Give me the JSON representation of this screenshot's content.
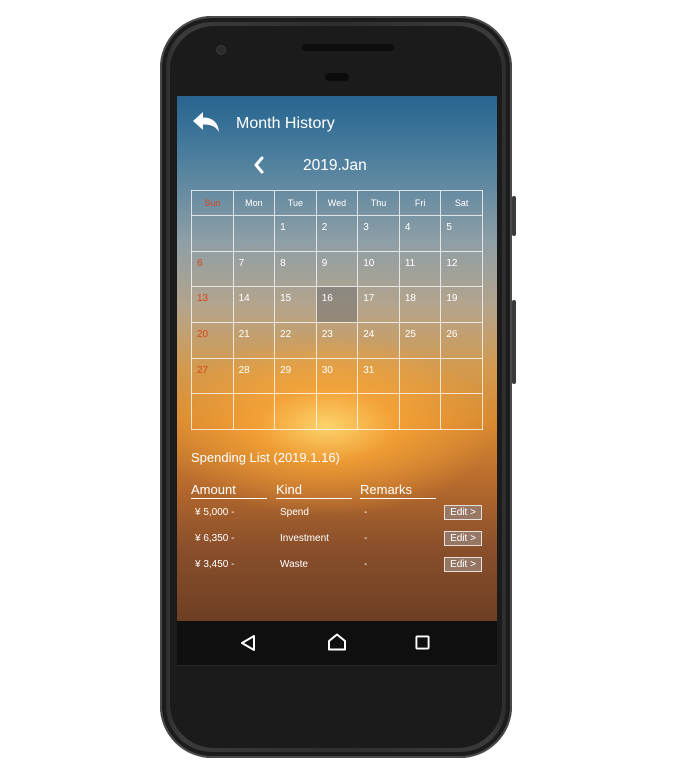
{
  "header": {
    "title": "Month History"
  },
  "calendar": {
    "month_label": "2019.Jan",
    "weekdays": [
      "Sun",
      "Mon",
      "Tue",
      "Wed",
      "Thu",
      "Fri",
      "Sat"
    ],
    "weeks": [
      [
        "",
        "",
        "1",
        "2",
        "3",
        "4",
        "5"
      ],
      [
        "6",
        "7",
        "8",
        "9",
        "10",
        "11",
        "12"
      ],
      [
        "13",
        "14",
        "15",
        "16",
        "17",
        "18",
        "19"
      ],
      [
        "20",
        "21",
        "22",
        "23",
        "24",
        "25",
        "26"
      ],
      [
        "27",
        "28",
        "29",
        "30",
        "31",
        "",
        ""
      ],
      [
        "",
        "",
        "",
        "",
        "",
        "",
        ""
      ]
    ],
    "selected_day": "16"
  },
  "spending": {
    "title": "Spending List (2019.1.16)",
    "columns": [
      "Amount",
      "Kind",
      "Remarks"
    ],
    "rows": [
      {
        "amount": "¥ 5,000 -",
        "kind": "Spend",
        "remarks": "-",
        "action": "Edit >"
      },
      {
        "amount": "¥ 6,350 -",
        "kind": "Investment",
        "remarks": "-",
        "action": "Edit >"
      },
      {
        "amount": "¥ 3,450 -",
        "kind": "Waste",
        "remarks": "-",
        "action": "Edit >"
      }
    ]
  },
  "icons": {
    "back": "back-arrow-icon",
    "prev": "chevron-left-icon",
    "nav": [
      "back-triangle-icon",
      "home-icon",
      "recents-icon"
    ]
  },
  "colors": {
    "sunday": "#d9441a",
    "selected_cell": "#6e6e6e",
    "phone_body": "#2e2e2e"
  }
}
